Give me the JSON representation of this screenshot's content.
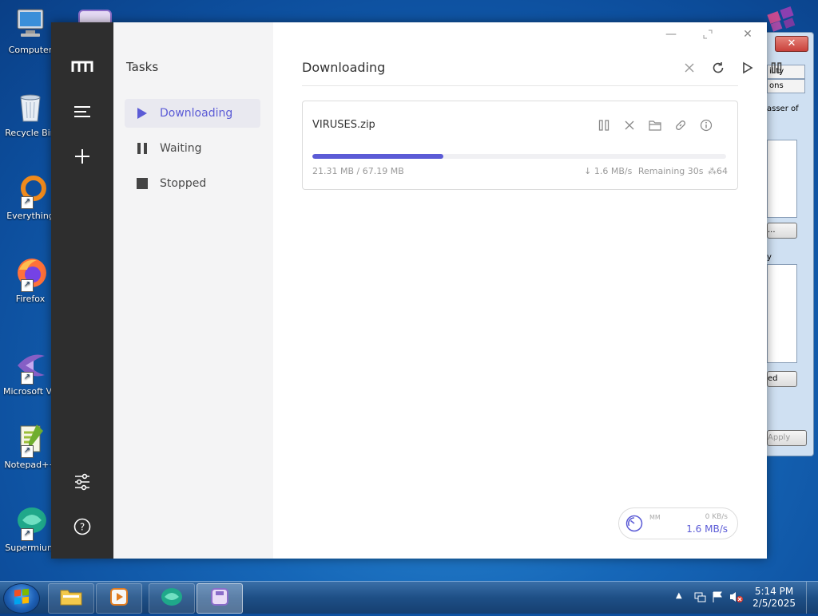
{
  "desktop": {
    "icons": [
      {
        "label": "Computer",
        "icon": "computer-icon"
      },
      {
        "label": "Recycle Bin",
        "icon": "recycle-bin-icon"
      },
      {
        "label": "Everything",
        "icon": "everything-icon"
      },
      {
        "label": "Firefox",
        "icon": "firefox-icon"
      },
      {
        "label": "Microsoft Visual Studio",
        "icon": "visual-studio-icon"
      },
      {
        "label": "Notepad++",
        "icon": "notepadpp-icon"
      },
      {
        "label": "Supermium",
        "icon": "supermium-icon"
      }
    ]
  },
  "background_dialog": {
    "close_label": "✕",
    "tabs": [
      "ility",
      "ons"
    ],
    "text_snippet": "asser of",
    "list_label": "y",
    "button_1": "...",
    "button_2": "ed",
    "apply_label": "Apply"
  },
  "app": {
    "sidebar_title": "Tasks",
    "sidebar_items": [
      {
        "label": "Downloading",
        "icon": "play-icon"
      },
      {
        "label": "Waiting",
        "icon": "pause-icon"
      },
      {
        "label": "Stopped",
        "icon": "stop-icon"
      }
    ],
    "header_title": "Downloading",
    "task": {
      "name": "VIRUSES.zip",
      "progress": 0.317,
      "sizes": "21.31 MB / 67.19 MB",
      "speed": "↓ 1.6 MB/s",
      "remaining": "Remaining 30s",
      "connections": "64"
    },
    "speedometer": {
      "mode": "MM",
      "upload": "0 KB/s",
      "download": "1.6 MB/s"
    }
  },
  "taskbar": {
    "time": "5:14 PM",
    "date": "2/5/2025"
  },
  "colors": {
    "accent": "#5b5bd6",
    "rail": "#2e2e2e"
  }
}
